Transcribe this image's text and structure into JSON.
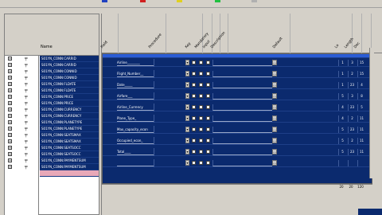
{
  "left": {
    "column_label": "Name",
    "rows": [
      "S01YN_CONN:CARRID",
      "S01YN_CONN:CARRID",
      "S01YN_CONN:CONNID",
      "S01YN_CONN:CONNID",
      "S01YN_CONN:FLDATE",
      "S01YN_CONN:FLDATE",
      "S01YN_CONN:PRICE",
      "S01YN_CONN:PRICE",
      "S01YN_CONN:CURRENCY",
      "S01YN_CONN:CURRENCY",
      "S01YN_CONN:PLANETYPE",
      "S01YN_CONN:PLANETYPE",
      "S01YN_CONN:SEATSMAX",
      "S01YN_CONN:SEATSMAX",
      "S01YN_CONN:SEATSOCC",
      "S01YN_CONN:SEATSOCC",
      "S01YN_CONN:PAYMENTSUM",
      "S01YN_CONN:PAYMENTSUM",
      ""
    ]
  },
  "grid": {
    "headers": [
      "Field",
      "Procedure",
      "Key",
      "Mandatory",
      "Input",
      "Description",
      "Default",
      "Lo",
      "Length",
      "Dec"
    ],
    "rows": [
      {
        "field": "",
        "n1": "",
        "n2": "",
        "n3": ""
      },
      {
        "field": "Airline________",
        "n1": "1",
        "n2": "3",
        "n3": "15"
      },
      {
        "field": "Flight_Number__",
        "n1": "1",
        "n2": "2",
        "n3": "15"
      },
      {
        "field": "Date_____",
        "n1": "1",
        "n2": "23",
        "n3": "4"
      },
      {
        "field": "Airfare___",
        "n1": "5",
        "n2": "3",
        "n3": "8"
      },
      {
        "field": "Airline_Currency",
        "n1": "4",
        "n2": "23",
        "n3": "5"
      },
      {
        "field": "Plane_Type_",
        "n1": "4",
        "n2": "2",
        "n3": "11"
      },
      {
        "field": "Max_capacity_econ",
        "n1": "5",
        "n2": "23",
        "n3": "11"
      },
      {
        "field": "Occupied_econ_",
        "n1": "5",
        "n2": "2",
        "n3": "11"
      },
      {
        "field": "Total____",
        "n1": "5",
        "n2": "23",
        "n3": "11"
      },
      {
        "field": "",
        "n1": "",
        "n2": "",
        "n3": ""
      }
    ],
    "footer": [
      "20",
      "20",
      "120"
    ]
  },
  "colors": {
    "window_bg": "#d4d0c8",
    "row_blue": "#0b2a6e",
    "selected_pink": "#e8a8b8"
  }
}
